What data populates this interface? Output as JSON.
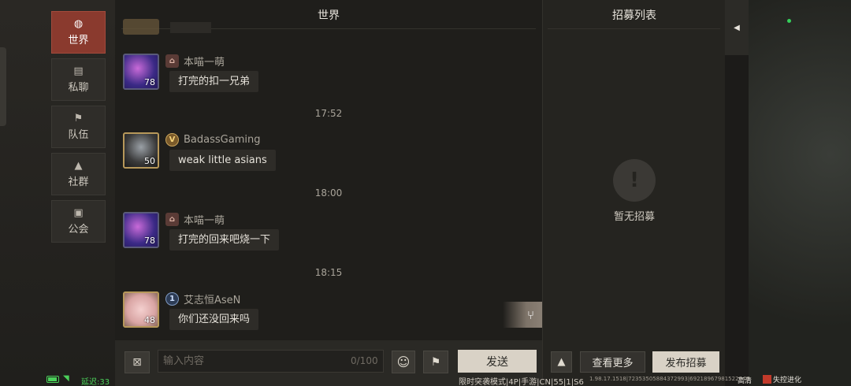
{
  "nav": {
    "items": [
      {
        "label": "世界",
        "icon": "globe-icon",
        "active": true
      },
      {
        "label": "私聊",
        "icon": "chat-icon",
        "active": false
      },
      {
        "label": "队伍",
        "icon": "flag-icon",
        "active": false
      },
      {
        "label": "社群",
        "icon": "campfire-icon",
        "active": false
      },
      {
        "label": "公会",
        "icon": "guild-banner-icon",
        "active": false
      }
    ]
  },
  "chat": {
    "title": "世界",
    "messages": [
      {
        "name": "本喵一萌",
        "level": "78",
        "text": "打完的扣一兄弟",
        "badge": "house-badge-icon"
      },
      {
        "time": "17:52"
      },
      {
        "name": "BadassGaming",
        "level": "50",
        "text": "weak little asians",
        "badge": "V"
      },
      {
        "time": "18:00"
      },
      {
        "name": "本喵一萌",
        "level": "78",
        "text": "打完的回来吧烧一下",
        "badge": "house-badge-icon"
      },
      {
        "time": "18:15"
      },
      {
        "name": "艾志恒AseN",
        "level": "48",
        "text": "你们还没回来吗",
        "badge": "1"
      }
    ]
  },
  "input": {
    "placeholder": "输入内容",
    "counter": "0/100",
    "send_label": "发送"
  },
  "recruit": {
    "title": "招募列表",
    "empty_text": "暂无招募",
    "more_label": "查看更多",
    "post_label": "发布招募"
  },
  "status": {
    "latency": "延迟:33",
    "build": "限时突袭模式|4P|手游|CN|55|1|S6",
    "ids": "1.98.17.1518|72353505884372993|69218967981522946",
    "quality": "高清",
    "logo": "失控进化"
  },
  "colors": {
    "accent": "#8a3a2e",
    "online": "#35d05a"
  }
}
